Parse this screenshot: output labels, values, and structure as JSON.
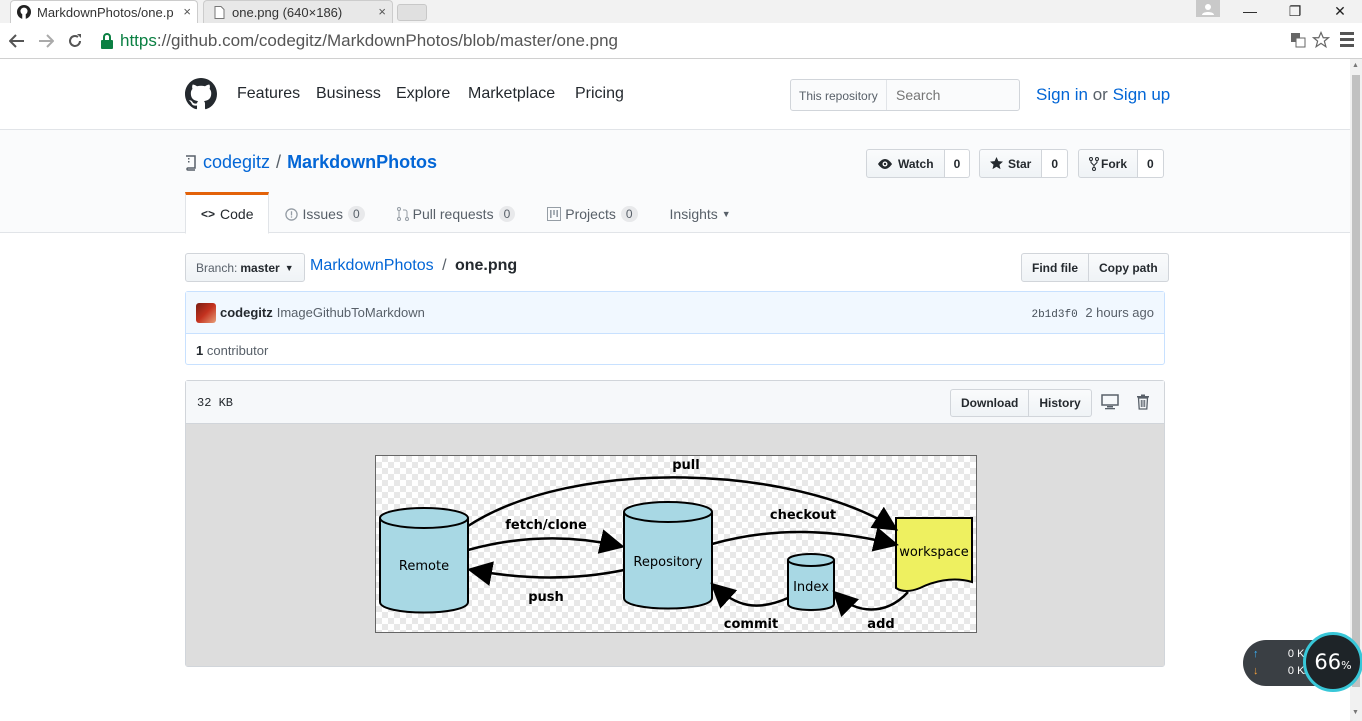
{
  "browser": {
    "tabs": [
      {
        "title": "MarkdownPhotos/one.p",
        "close": "×"
      },
      {
        "title": "one.png (640×186)",
        "close": "×"
      }
    ],
    "url_scheme": "https",
    "url_rest": "://github.com/codegitz/MarkdownPhotos/blob/master/one.png",
    "window_buttons": {
      "minimize": "—",
      "restore": "❐",
      "close": "✕"
    }
  },
  "header": {
    "nav": [
      "Features",
      "Business",
      "Explore",
      "Marketplace",
      "Pricing"
    ],
    "search_scope": "This repository",
    "search_placeholder": "Search",
    "sign_in": "Sign in",
    "or": "or",
    "sign_up": "Sign up"
  },
  "repo": {
    "owner": "codegitz",
    "separator": "/",
    "name": "MarkdownPhotos",
    "watch_label": "Watch",
    "watch_count": "0",
    "star_label": "Star",
    "star_count": "0",
    "fork_label": "Fork",
    "fork_count": "0",
    "tabs": [
      {
        "label": "Code"
      },
      {
        "label": "Issues",
        "count": "0"
      },
      {
        "label": "Pull requests",
        "count": "0"
      },
      {
        "label": "Projects",
        "count": "0"
      },
      {
        "label": "Insights"
      }
    ]
  },
  "file_nav": {
    "branch_label": "Branch:",
    "branch": "master",
    "breadcrumb_repo": "MarkdownPhotos",
    "breadcrumb_sep": "/",
    "file_name": "one.png",
    "find_file": "Find file",
    "copy_path": "Copy path"
  },
  "commit": {
    "author": "codegitz",
    "message": "ImageGithubToMarkdown",
    "sha": "2b1d3f0",
    "time": "2 hours ago",
    "contributors_count": "1",
    "contributors_label": "contributor"
  },
  "file": {
    "size": "32 KB",
    "download": "Download",
    "history": "History"
  },
  "diagram": {
    "nodes": [
      "Remote",
      "Repository",
      "Index",
      "workspace"
    ],
    "edges": [
      "pull",
      "fetch/clone",
      "push",
      "checkout",
      "commit",
      "add"
    ]
  },
  "net_widget": {
    "up_speed": "0",
    "up_unit": "K/s",
    "down_speed": "0",
    "down_unit": "K/s",
    "percent": "66",
    "percent_sign": "%"
  },
  "colors": {
    "link": "#0366d6",
    "selected_tab_border": "#e36209",
    "workspace_fill": "#eef060",
    "node_fill": "#a8d8e4"
  }
}
